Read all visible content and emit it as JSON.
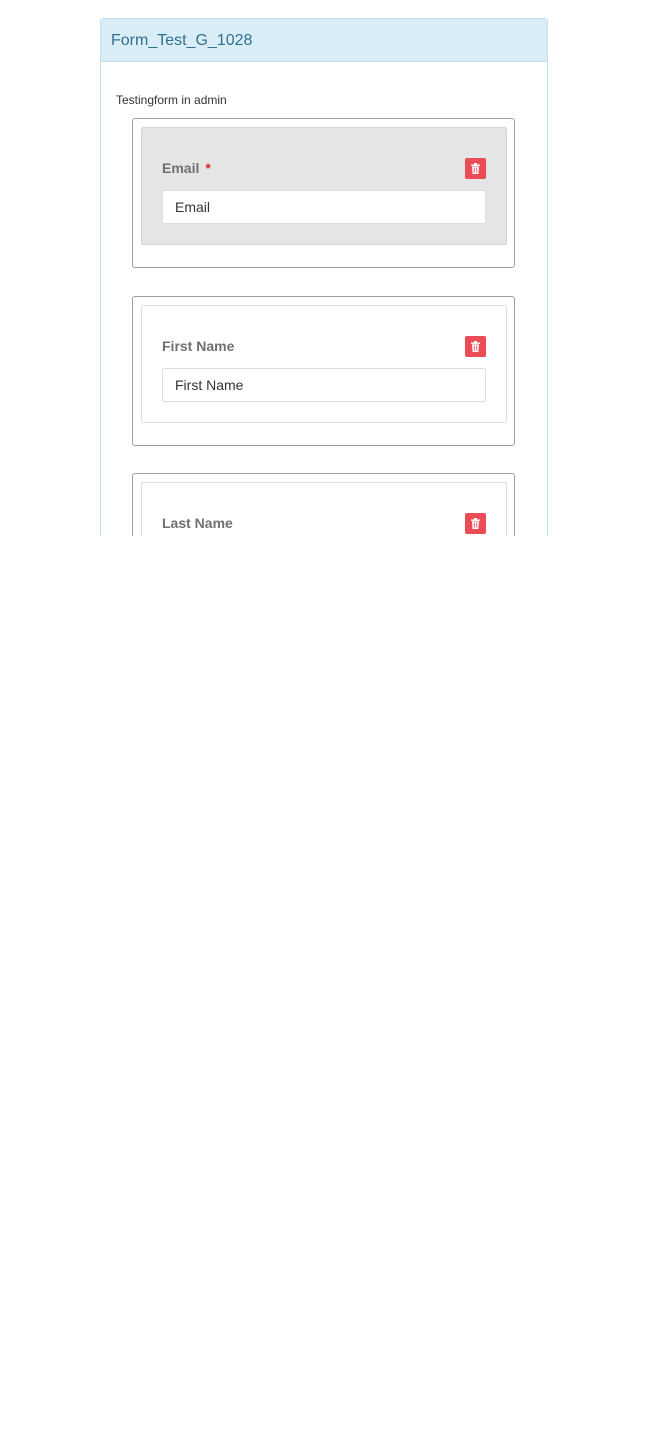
{
  "form": {
    "title": "Form_Test_G_1028",
    "description": "Testingform in admin"
  },
  "fields": [
    {
      "label": "Email",
      "required_mark": "*",
      "placeholder": "Email"
    },
    {
      "label": "First Name",
      "placeholder": "First Name"
    },
    {
      "label": "Last Name"
    }
  ],
  "colors": {
    "heading_bg": "#d9edf7",
    "heading_text": "#31708f",
    "delete_button": "#ea4d55",
    "required": "#d9262c",
    "active_field_bg": "#e5e5e5"
  },
  "icons": {
    "delete": "trash-icon"
  }
}
